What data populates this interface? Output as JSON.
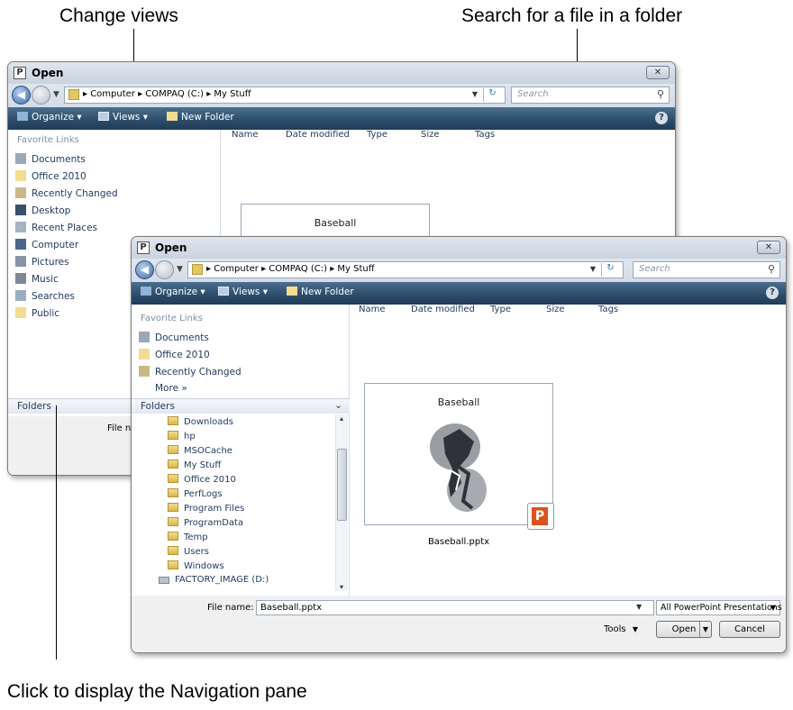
{
  "annotations": {
    "change_views": "Change views",
    "search_folder": "Search for a file in a folder",
    "nav_pane": "Click to display the Navigation pane"
  },
  "back_dialog": {
    "title": "Open",
    "address_path": "▸  Computer  ▸  COMPAQ (C:)  ▸  My Stuff",
    "search_placeholder": "Search",
    "toolbar": {
      "organize": "Organize",
      "views": "Views",
      "new_folder": "New Folder"
    },
    "favorite_links_heading": "Favorite Links",
    "favorite_links": [
      "Documents",
      "Office 2010",
      "Recently Changed",
      "Desktop",
      "Recent Places",
      "Computer",
      "Pictures",
      "Music",
      "Searches",
      "Public"
    ],
    "columns": [
      "Name",
      "Date modified",
      "Type",
      "Size",
      "Tags"
    ],
    "folders_label": "Folders",
    "file_name_label": "File name",
    "thumbnail_title": "Baseball"
  },
  "front_dialog": {
    "title": "Open",
    "address_path": "▸  Computer  ▸  COMPAQ (C:)  ▸  My Stuff",
    "search_placeholder": "Search",
    "toolbar": {
      "organize": "Organize",
      "views": "Views",
      "new_folder": "New Folder"
    },
    "favorite_links_heading": "Favorite Links",
    "favorite_links": [
      "Documents",
      "Office 2010",
      "Recently Changed"
    ],
    "more_label": "More »",
    "folders_label": "Folders",
    "tree": [
      "Downloads",
      "hp",
      "MSOCache",
      "My Stuff",
      "Office 2010",
      "PerfLogs",
      "Program Files",
      "ProgramData",
      "Temp",
      "Users",
      "Windows",
      "FACTORY_IMAGE (D:)"
    ],
    "columns": [
      "Name",
      "Date modified",
      "Type",
      "Size",
      "Tags"
    ],
    "thumbnail_title": "Baseball",
    "file_caption": "Baseball.pptx",
    "file_name_label": "File name:",
    "file_name_value": "Baseball.pptx",
    "file_type": "All PowerPoint Presentations",
    "tools_label": "Tools",
    "open_label": "Open",
    "cancel_label": "Cancel"
  },
  "colors": {
    "toolbar_dark": "#2e4e6c",
    "link_text": "#1e395b",
    "folder_yellow": "#e0c768"
  },
  "icons": {
    "back": "back-arrow-icon",
    "forward": "forward-arrow-icon",
    "refresh": "refresh-icon",
    "search": "search-icon",
    "help": "help-icon",
    "close": "close-icon",
    "folder": "folder-icon",
    "powerpoint": "powerpoint-icon"
  }
}
